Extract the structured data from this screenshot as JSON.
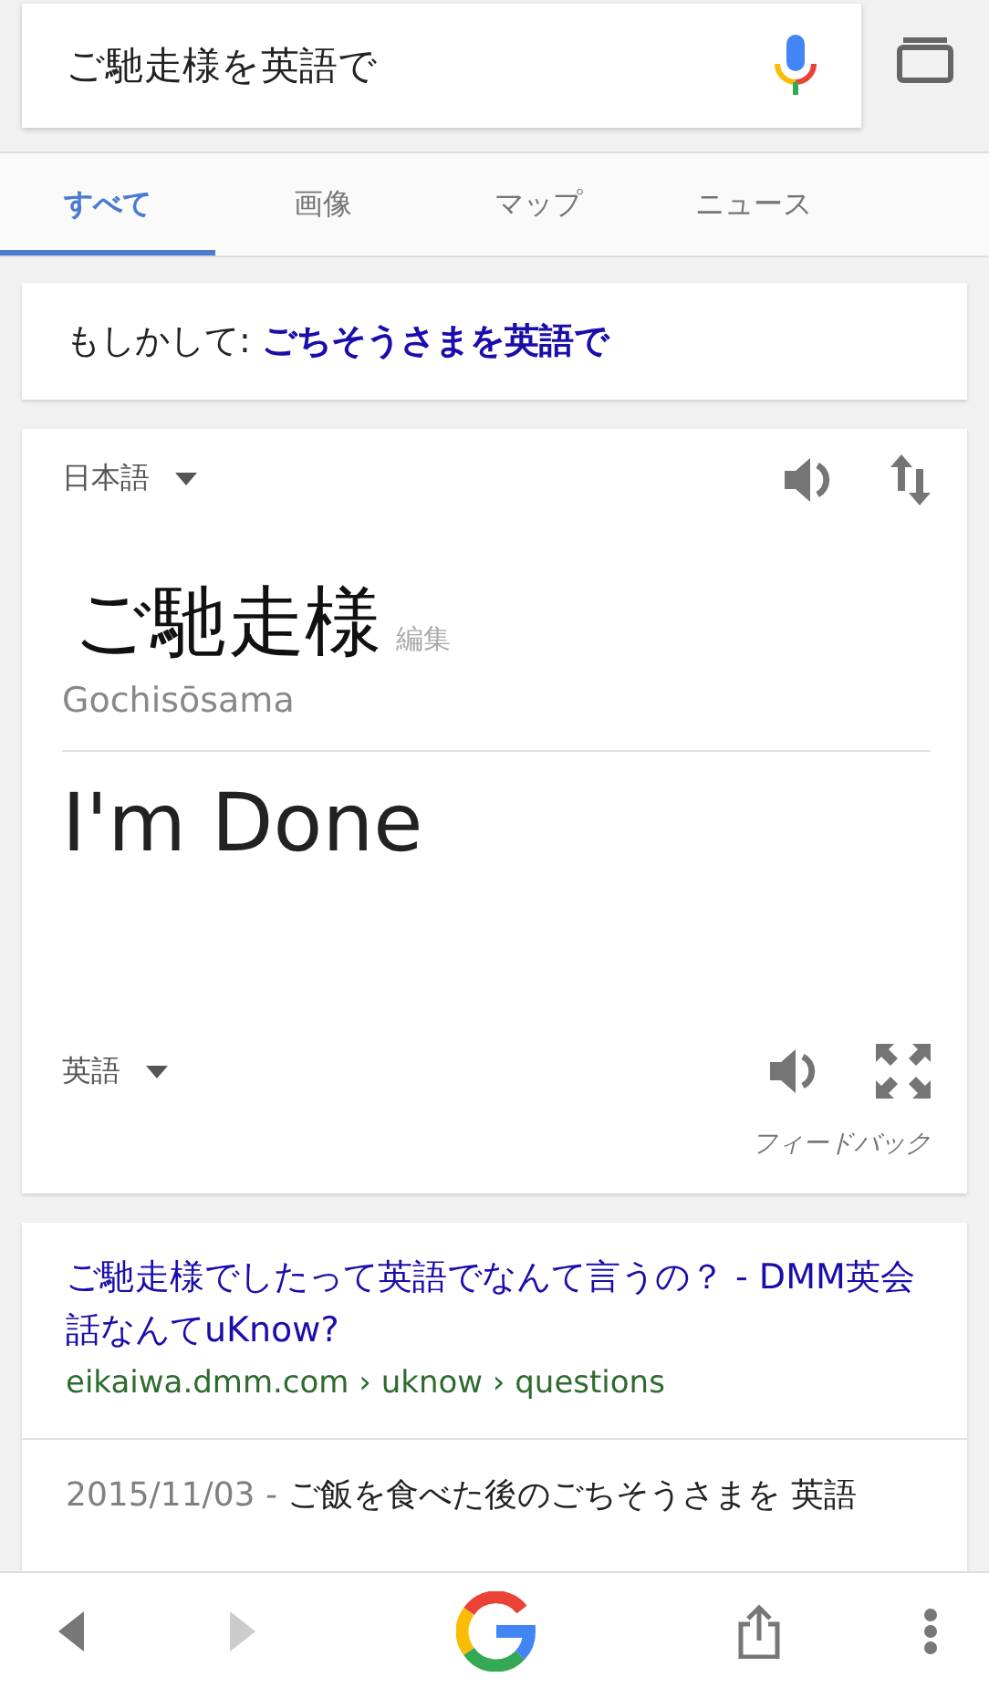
{
  "search": {
    "value": "ご馳走様を英語で"
  },
  "tabs": [
    {
      "label": "すべて",
      "selected": true
    },
    {
      "label": "画像",
      "selected": false
    },
    {
      "label": "マップ",
      "selected": false
    },
    {
      "label": "ニュース",
      "selected": false
    }
  ],
  "suggestion": {
    "prefix": "もしかして:",
    "query": "ごちそうさまを英語で"
  },
  "translator": {
    "source_language": "日本語",
    "source_text": "ご馳走様",
    "edit_label": "編集",
    "romanization": "Gochisōsama",
    "translation": "I'm Done",
    "target_language": "英語",
    "feedback": "フィードバック"
  },
  "result": {
    "title": "ご馳走様でしたって英語でなんて言うの？ - DMM英会話なんてuKnow?",
    "url": "eikaiwa.dmm.com › uknow › questions",
    "date": "2015/11/03 -",
    "snippet": "ご飯を食べた後のごちそうさまを 英語"
  },
  "bottom_bar": {
    "back_enabled": true,
    "forward_enabled": false
  }
}
